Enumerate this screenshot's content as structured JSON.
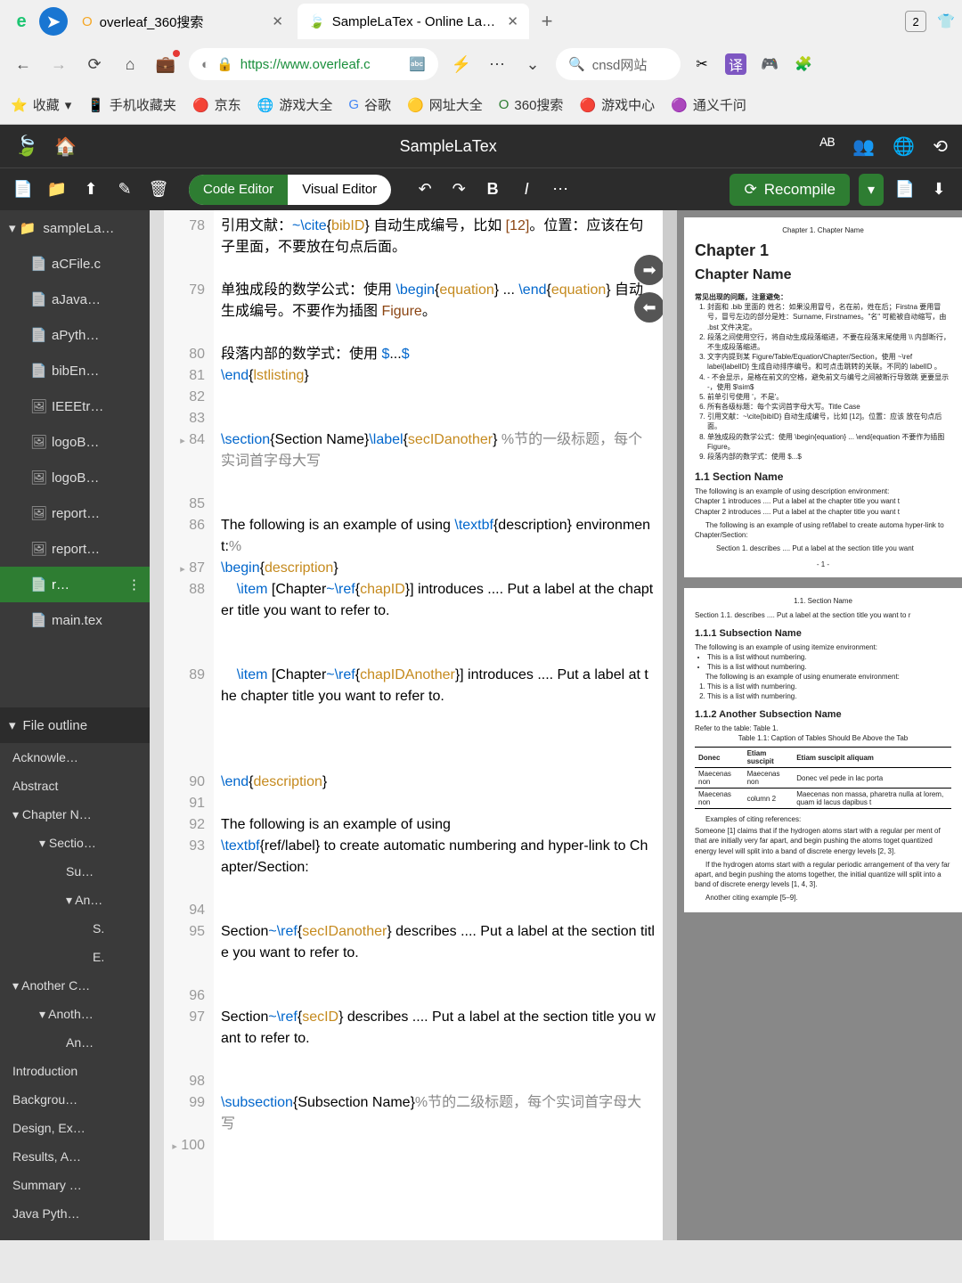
{
  "browser": {
    "tabs": [
      {
        "icon": "O",
        "label": "overleaf_360搜索"
      },
      {
        "icon": "🍃",
        "label": "SampleLaTex - Online LaTeX"
      }
    ],
    "badge": "2",
    "url": "https://www.overleaf.c",
    "search_placeholder": "cnsd网站",
    "bookmarks": [
      "收藏",
      "手机收藏夹",
      "京东",
      "游戏大全",
      "谷歌",
      "网址大全",
      "360搜索",
      "游戏中心",
      "通义千问"
    ]
  },
  "overleaf": {
    "title": "SampleLaTex",
    "toggle": {
      "code": "Code Editor",
      "visual": "Visual Editor"
    },
    "recompile": "Recompile"
  },
  "files": {
    "root": "sampleLa…",
    "items": [
      "aCFile.c",
      "aJava…",
      "aPyth…",
      "bibEn…",
      "IEEEtr…",
      "logoB…",
      "logoB…",
      "report…",
      "report…",
      "r…",
      "main.tex"
    ],
    "selected_index": 9
  },
  "outline": {
    "title": "File outline",
    "items": [
      {
        "l": 1,
        "t": "Acknowle…"
      },
      {
        "l": 1,
        "t": "Abstract"
      },
      {
        "l": 1,
        "t": "Chapter N…",
        "exp": true
      },
      {
        "l": 2,
        "t": "Sectio…",
        "exp": true
      },
      {
        "l": 3,
        "t": "Su…"
      },
      {
        "l": 3,
        "t": "An…",
        "exp": true
      },
      {
        "l": 4,
        "t": "S."
      },
      {
        "l": 4,
        "t": "E."
      },
      {
        "l": 1,
        "t": "Another C…",
        "exp": true
      },
      {
        "l": 2,
        "t": "Anoth…",
        "exp": true
      },
      {
        "l": 3,
        "t": "An…"
      },
      {
        "l": 1,
        "t": "Introduction"
      },
      {
        "l": 1,
        "t": "Backgrou…"
      },
      {
        "l": 1,
        "t": "Design, Ex…"
      },
      {
        "l": 1,
        "t": "Results, A…"
      },
      {
        "l": 1,
        "t": "Summary …"
      },
      {
        "l": 1,
        "t": "Java Pyth…"
      }
    ]
  },
  "code": {
    "start": 78,
    "lines": [
      {
        "n": 78,
        "h": 3,
        "html": "引用文献：<span class='c-cmd'>~\\cite</span>{<span class='c-arg'>bibID</span>} 自动生成编号，比如 <span class='c-str'>[12]</span>。位置：应该在句子里面，不要放在句点后面。"
      },
      {
        "n": 79,
        "h": 3,
        "html": "单独成段的数学公式：使用 <span class='c-cmd'>\\begin</span>{<span class='c-arg'>equation</span>} ... <span class='c-cmd'>\\end</span>{<span class='c-arg'>equation</span>} 自动生成编号。不要作为插图 <span class='c-str'>Figure</span>。"
      },
      {
        "n": 80,
        "h": 1,
        "html": "段落内部的数学式：使用 <span class='c-cmd'>$</span>...<span class='c-cmd'>$</span>"
      },
      {
        "n": 81,
        "h": 1,
        "html": "<span class='c-cmd'>\\end</span>{<span class='c-arg'>lstlisting</span>}"
      },
      {
        "n": 82,
        "h": 1,
        "html": ""
      },
      {
        "n": 83,
        "h": 1,
        "html": ""
      },
      {
        "n": 84,
        "h": 3,
        "fold": true,
        "html": "<span class='c-cmd'>\\section</span>{Section Name}<span class='c-cmd'>\\label</span>{<span class='c-arg'>secIDanother</span>} <span class='c-cmt'>%节的一级标题，每个实词首字母大写</span>"
      },
      {
        "n": 85,
        "h": 1,
        "html": ""
      },
      {
        "n": 86,
        "h": 2,
        "html": "The following is an example of using <span class='c-cmd'>\\textbf</span>{description} environment:<span class='c-cmt'>%</span>"
      },
      {
        "n": 87,
        "h": 1,
        "fold": true,
        "html": "<span class='c-cmd'>\\begin</span>{<span class='c-arg'>description</span>}"
      },
      {
        "n": 88,
        "h": 4,
        "html": "    <span class='c-cmd'>\\item</span> [Chapter<span class='c-cmd'>~\\ref</span>{<span class='c-arg'>chapID</span>}] introduces .... Put a label at the chapter title you want to refer to."
      },
      {
        "n": 89,
        "h": 5,
        "html": "    <span class='c-cmd'>\\item</span> [Chapter<span class='c-cmd'>~\\ref</span>{<span class='c-arg'>chapIDAnother</span>}] introduces .... Put a label at the chapter title you want to refer to."
      },
      {
        "n": 90,
        "h": 1,
        "html": "<span class='c-cmd'>\\end</span>{<span class='c-arg'>description</span>}"
      },
      {
        "n": 91,
        "h": 1,
        "html": ""
      },
      {
        "n": 92,
        "h": 1,
        "html": "The following is an example of using"
      },
      {
        "n": 93,
        "h": 3,
        "html": "<span class='c-cmd'>\\textbf</span>{ref/label} to create automatic numbering and hyper-link to Chapter/Section:"
      },
      {
        "n": 94,
        "h": 1,
        "html": ""
      },
      {
        "n": 95,
        "h": 3,
        "html": "Section<span class='c-cmd'>~\\ref</span>{<span class='c-arg'>secIDanother</span>} describes .... Put a label at the section title you want to refer to."
      },
      {
        "n": 96,
        "h": 1,
        "html": ""
      },
      {
        "n": 97,
        "h": 3,
        "html": "Section<span class='c-cmd'>~\\ref</span>{<span class='c-arg'>secID</span>} describes .... Put a label at the section title you want to refer to."
      },
      {
        "n": 98,
        "h": 1,
        "html": ""
      },
      {
        "n": 99,
        "h": 2,
        "html": "<span class='c-cmd'>\\subsection</span>{Subsection Name}<span class='c-cmt'>%节的二级标题，每个实词首字母大写</span>"
      },
      {
        "n": 100,
        "h": 1,
        "fold": true,
        "html": ""
      }
    ]
  },
  "pdf": {
    "page1": {
      "header": "Chapter 1. Chapter Name",
      "chap": "Chapter 1",
      "chapname": "Chapter Name",
      "warn": "常见出现的问题，注意避免：",
      "bullets": [
        "封面和 .bib 里面的 姓名：如果没用冒号，名在前，姓在后；Firstna 要用冒号，冒号左边的部分是姓：Surname, Firstnames。\"名\" 可能被自动缩写，由 .bst 文件决定。",
        "段落之间使用空行，将自动生成段落缩进，不要在段落末尾使用 \\\\ 内部断行，不生成段落缩进。",
        "文字内提到某 Figure/Table/Equation/Chapter/Section，使用 ~\\ref label{labelID} 生成自动排序编号。和可点击跳转的关联。不同的 labelID 。",
        "- 不会显示，是格在前文的空格，避免前文与编号之间被断行导致跳 更要显示 -，使用 $\\sim$",
        "前单引号使用 '，不是'。",
        "所有各级标题：每个实词首字母大写。Title Case",
        "引用文献：~\\cite{bibID} 自动生成编号，比如 [12]。位置：应该 放在句点后面。",
        "单独成段的数学公式：使用 \\begin{equation} ... \\end{equation 不要作为插图 Figure。",
        "段落内部的数学式：使用 $...$"
      ],
      "sec": "1.1   Section Name",
      "secbody": "The following is an example of using description environment:",
      "desc": [
        "Chapter 1  introduces .... Put a label at the chapter title you want t",
        "Chapter 2  introduces .... Put a label at the chapter title you want t"
      ],
      "secbody2": "The following is an example of using ref/label to create automa hyper-link to Chapter/Section:",
      "secref": "Section 1.  describes .... Put a label at the section title you want",
      "pnum": "- 1 -"
    },
    "page2": {
      "header": "1.1.  Section Name",
      "secref": "Section 1.1.  describes .... Put a label at the section title you want to r",
      "sub1": "1.1.1   Subsection Name",
      "sub1body": "The following is an example of using itemize environment:",
      "itemize": [
        "This is a list without numbering.",
        "This is a list without numbering."
      ],
      "sub1body2": "The following is an example of using enumerate environment:",
      "enum": [
        "This is a list with numbering.",
        "This is a list with numbering."
      ],
      "sub2": "1.1.2   Another Subsection Name",
      "tblref": "Refer to the table: Table 1.",
      "tblcap": "Table 1.1: Caption of Tables Should Be Above the Tab",
      "tbl": {
        "head": [
          "Donec",
          "Etiam suscipit",
          "Etiam suscipit aliquam"
        ],
        "rows": [
          [
            "Maecenas non",
            "Maecenas non",
            "Donec vel pede in lac porta"
          ],
          [
            "Maecenas non",
            "column 2",
            "Maecenas non massa, pharetra nulla at lorem, quam id lacus dapibus t"
          ]
        ]
      },
      "cite": "Examples of citing references:",
      "citebody": "Someone [1] claims that if the hydrogen atoms start with a regular per ment of that are initially very far apart, and begin pushing the atoms toget quantized energy level will split into a band of discrete energy levels [2, 3].",
      "citebody2": "If the hydrogen atoms start with a regular periodic arrangement of tha very far apart, and begin pushing the atoms together, the initial quantize will split into a band of discrete energy levels [1, 4, 3].",
      "citebody3": "Another citing example [5–9]."
    }
  }
}
